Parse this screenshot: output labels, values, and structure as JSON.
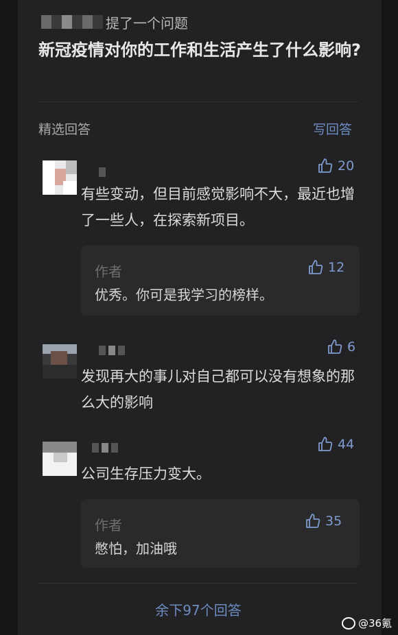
{
  "question": {
    "asker_suffix": "提了一个问题",
    "title": "新冠疫情对你的工作和生活产生了什么影响?"
  },
  "section": {
    "title": "精选回答",
    "write_label": "写回答"
  },
  "answers": [
    {
      "likes": "20",
      "text": "有些变动，但目前感觉影响不大，最近也增了一些人，在探索新项目。",
      "reply": {
        "label": "作者",
        "likes": "12",
        "text": "优秀。你可是我学习的榜样。"
      }
    },
    {
      "likes": "6",
      "text": "发现再大的事儿对自己都可以没有想象的那么大的影响"
    },
    {
      "likes": "44",
      "text": "公司生存压力变大。",
      "reply": {
        "label": "作者",
        "likes": "35",
        "text": "憋怕，加油哦"
      }
    }
  ],
  "footer": {
    "more_label": "余下97个回答"
  },
  "watermark": {
    "text": "@36氪"
  },
  "colors": {
    "accent": "#7f9bd0",
    "background": "#222224",
    "text": "#dcdcde"
  },
  "icons": {
    "like": "thumbs-up-icon"
  }
}
